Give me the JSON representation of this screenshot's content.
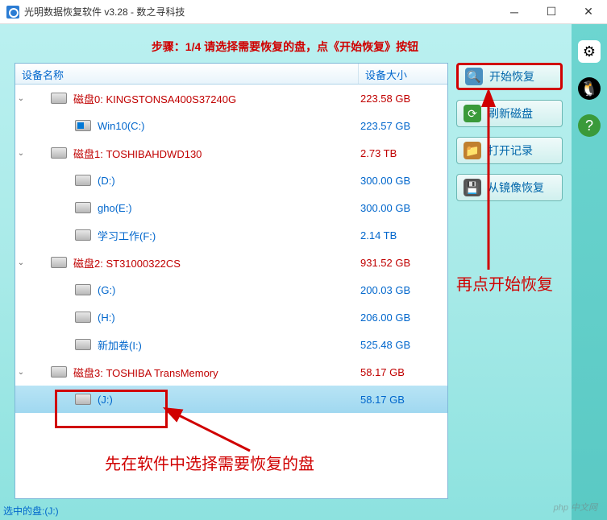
{
  "window": {
    "title": "光明数据恢复软件 v3.28 - 数之寻科技"
  },
  "step_header": "步骤：1/4 请选择需要恢复的盘，点《开始恢复》按钮",
  "columns": {
    "name": "设备名称",
    "size": "设备大小"
  },
  "tree": [
    {
      "type": "disk",
      "name": "磁盘0: KINGSTONSA400S37240G",
      "size": "223.58 GB",
      "expanded": true,
      "children": [
        {
          "type": "vol",
          "icon": "win",
          "name": "Win10(C:)",
          "size": "223.57 GB"
        }
      ]
    },
    {
      "type": "disk",
      "name": "磁盘1: TOSHIBAHDWD130",
      "size": "2.73 TB",
      "expanded": true,
      "children": [
        {
          "type": "vol",
          "name": "(D:)",
          "size": "300.00 GB"
        },
        {
          "type": "vol",
          "name": "gho(E:)",
          "size": "300.00 GB"
        },
        {
          "type": "vol",
          "name": "学习工作(F:)",
          "size": "2.14 TB"
        }
      ]
    },
    {
      "type": "disk",
      "name": "磁盘2: ST31000322CS",
      "size": "931.52 GB",
      "expanded": true,
      "children": [
        {
          "type": "vol",
          "name": "(G:)",
          "size": "200.03 GB"
        },
        {
          "type": "vol",
          "name": "(H:)",
          "size": "206.00 GB"
        },
        {
          "type": "vol",
          "name": "新加卷(I:)",
          "size": "525.48 GB"
        }
      ]
    },
    {
      "type": "disk",
      "name": "磁盘3: TOSHIBA  TransMemory",
      "size": "58.17 GB",
      "expanded": true,
      "children": [
        {
          "type": "vol",
          "name": "(J:)",
          "size": "58.17 GB",
          "selected": true
        }
      ]
    }
  ],
  "buttons": {
    "start": "开始恢复",
    "refresh": "刷新磁盘",
    "open_log": "打开记录",
    "from_image": "从镜像恢复"
  },
  "annotations": {
    "right": "再点开始恢复",
    "bottom": "先在软件中选择需要恢复的盘"
  },
  "statusbar": "选中的盘:(J:)",
  "watermark": "php 中文网"
}
